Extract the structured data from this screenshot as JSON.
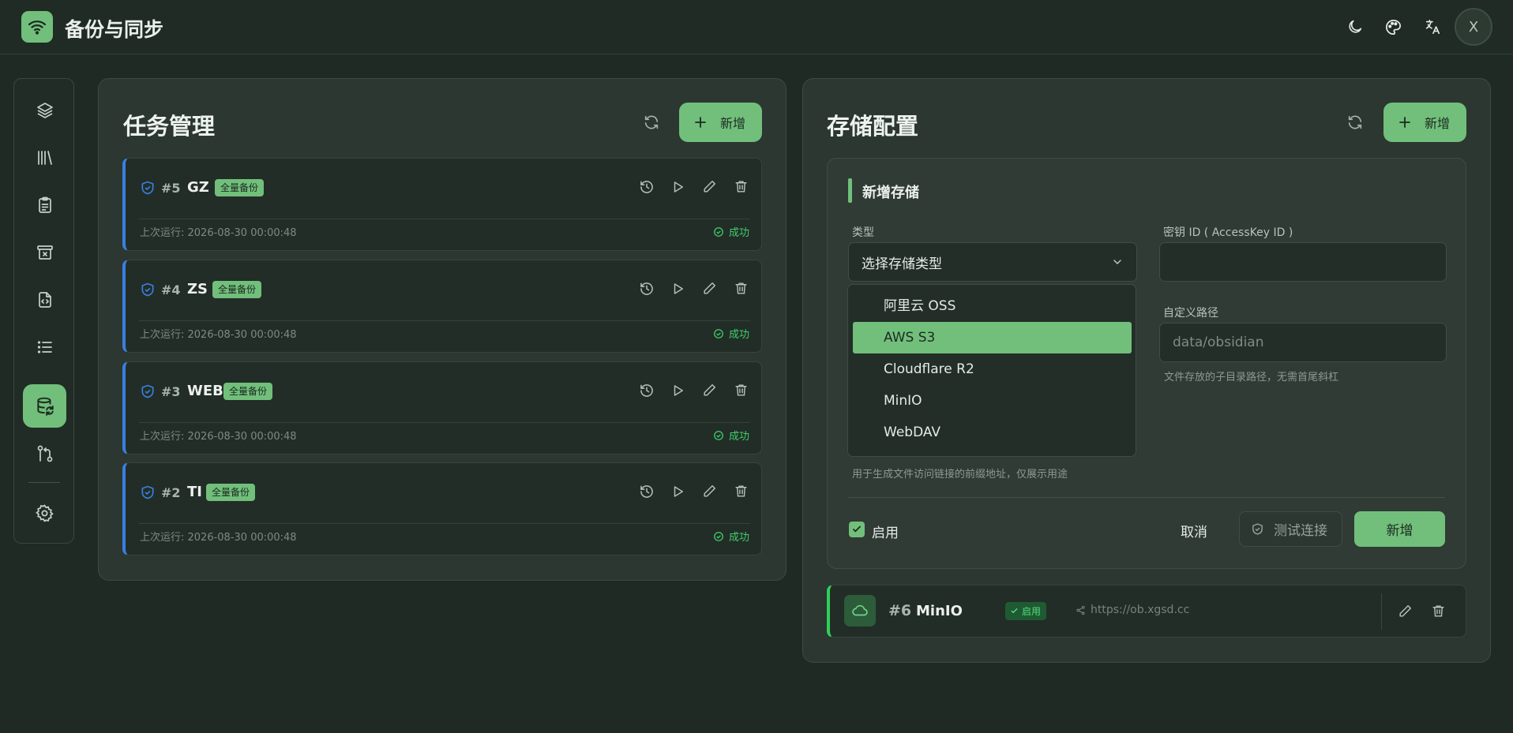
{
  "app": {
    "title": "备份与同步",
    "avatar": "X"
  },
  "header_icons": [
    "theme-moon-icon",
    "palette-icon",
    "translate-icon"
  ],
  "sidebar": {
    "items": [
      "layers-icon",
      "library-icon",
      "clipboard-icon",
      "archive-x-icon",
      "file-code-icon",
      "list-icon",
      "database-sync-icon",
      "git-compare-icon",
      "settings-icon"
    ],
    "active": "database-sync-icon"
  },
  "tasks_panel": {
    "title": "任务管理",
    "add_label": "新增",
    "tasks": [
      {
        "id": "#5",
        "name": "GZ",
        "badge": "全量备份",
        "last_run": "上次运行: 2026-08-30 00:00:48",
        "status": "成功"
      },
      {
        "id": "#4",
        "name": "ZS",
        "badge": "全量备份",
        "last_run": "上次运行: 2026-08-30 00:00:48",
        "status": "成功"
      },
      {
        "id": "#3",
        "name": "WEB",
        "badge": "全量备份",
        "last_run": "上次运行: 2026-08-30 00:00:48",
        "status": "成功"
      },
      {
        "id": "#2",
        "name": "TI",
        "badge": "全量备份",
        "last_run": "上次运行: 2026-08-30 00:00:48",
        "status": "成功"
      }
    ]
  },
  "storage_panel": {
    "title": "存储配置",
    "add_label": "新增",
    "form": {
      "heading": "新增存储",
      "type_label": "类型",
      "type_value": "选择存储类型",
      "type_options": [
        "阿里云 OSS",
        "AWS S3",
        "Cloudflare R2",
        "MinIO",
        "WebDAV"
      ],
      "highlighted_option": "AWS S3",
      "accesskey_label": "密钥 ID ( AccessKey ID )",
      "accesskey_value": "",
      "path_label": "自定义路径",
      "path_placeholder": "data/obsidian",
      "path_hint": "文件存放的子目录路径，无需首尾斜杠",
      "prefix_hint": "用于生成文件访问链接的前缀地址，仅展示用途",
      "enable_label": "启用",
      "enabled": true,
      "cancel_label": "取消",
      "test_label": "测试连接",
      "submit_label": "新增"
    },
    "items": [
      {
        "id": "#6",
        "name": "MinIO",
        "badge": "启用",
        "url": "https://ob.xgsd.cc"
      }
    ]
  },
  "colors": {
    "accent": "#71bf7b",
    "task_border": "#3a7fe0",
    "success": "#3fcf6a",
    "storage_border": "#2fcf59"
  }
}
